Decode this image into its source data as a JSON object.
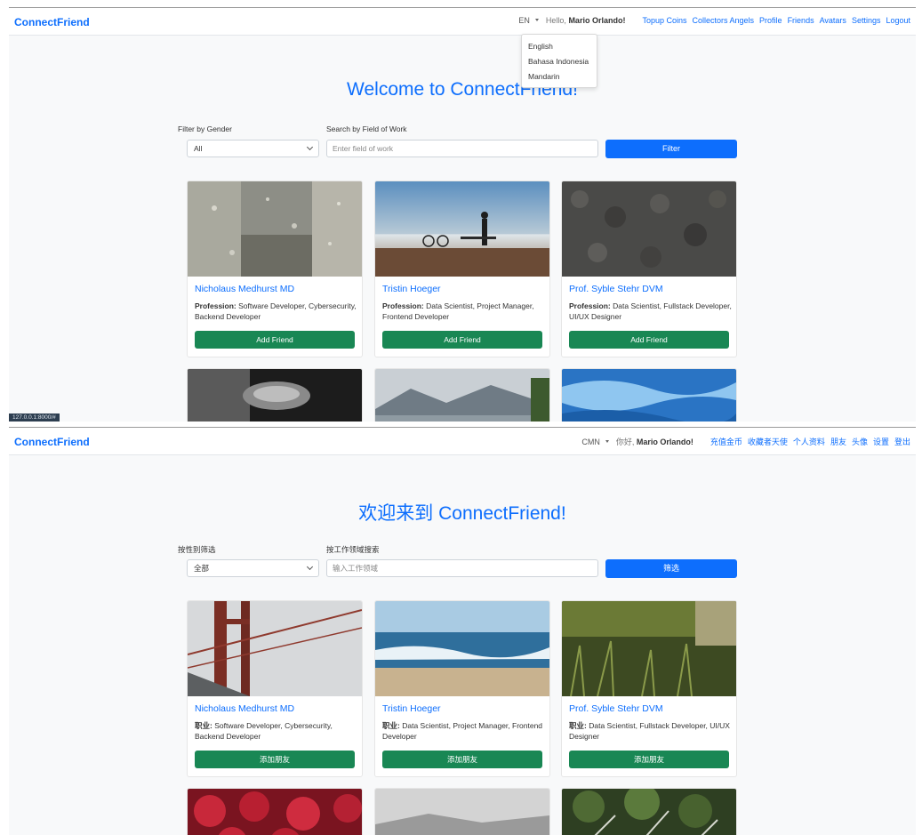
{
  "screen_en": {
    "brand": "ConnectFriend",
    "lang_current": "EN",
    "greeting_prefix": "Hello,",
    "greeting_name": "Mario Orlando!",
    "nav_links": [
      "Topup Coins",
      "Collectors Angels",
      "Profile",
      "Friends",
      "Avatars",
      "Settings",
      "Logout"
    ],
    "lang_options": [
      "English",
      "Bahasa Indonesia",
      "Mandarin"
    ],
    "title": "Welcome to ConnectFriend!",
    "filter_gender_label": "Filter by Gender",
    "gender_value": "All",
    "search_label": "Search by Field of Work",
    "search_placeholder": "Enter field of work",
    "filter_button": "Filter",
    "profession_label": "Profession:",
    "add_friend": "Add Friend",
    "cards": [
      {
        "name": "Nicholaus Medhurst MD",
        "profession": "Software Developer, Cybersecurity, Backend Developer"
      },
      {
        "name": "Tristin Hoeger",
        "profession": "Data Scientist, Project Manager, Frontend Developer"
      },
      {
        "name": "Prof. Syble Stehr DVM",
        "profession": "Data Scientist, Fullstack Developer, UI/UX Designer"
      }
    ],
    "status_url": "127.0.0.1:8000/#"
  },
  "screen_cn": {
    "brand": "ConnectFriend",
    "lang_current": "CMN",
    "greeting_prefix": "你好,",
    "greeting_name": "Mario Orlando!",
    "nav_links": [
      "充值金币",
      "收藏者天使",
      "个人资料",
      "朋友",
      "头像",
      "设置",
      "登出"
    ],
    "title": "欢迎来到 ConnectFriend!",
    "filter_gender_label": "按性别筛选",
    "gender_value": "全部",
    "search_label": "按工作领域搜索",
    "search_placeholder": "输入工作领域",
    "filter_button": "筛选",
    "profession_label": "职业:",
    "add_friend": "添加朋友",
    "cards": [
      {
        "name": "Nicholaus Medhurst MD",
        "profession": "Software Developer, Cybersecurity, Backend Developer"
      },
      {
        "name": "Tristin Hoeger",
        "profession": "Data Scientist, Project Manager, Frontend Developer"
      },
      {
        "name": "Prof. Syble Stehr DVM",
        "profession": "Data Scientist, Fullstack Developer, UI/UX Designer"
      }
    ]
  },
  "colors": {
    "primary": "#0d6efd",
    "success": "#198754",
    "background": "#f8f9fa"
  }
}
